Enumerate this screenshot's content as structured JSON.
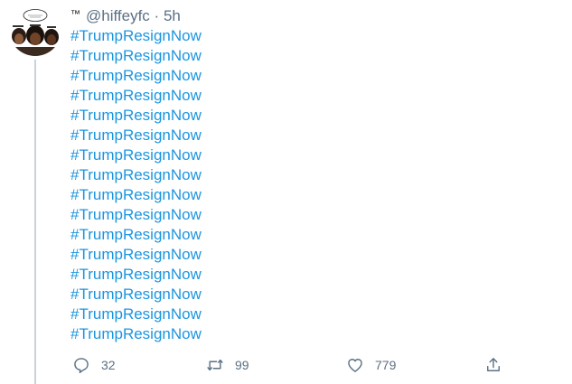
{
  "tweet": {
    "display_name": "™",
    "handle": "@hiffeyfc",
    "separator": "·",
    "time": "5h",
    "hashtags": [
      "#TrumpResignNow",
      "#TrumpResignNow",
      "#TrumpResignNow",
      "#TrumpResignNow",
      "#TrumpResignNow",
      "#TrumpResignNow",
      "#TrumpResignNow",
      "#TrumpResignNow",
      "#TrumpResignNow",
      "#TrumpResignNow",
      "#TrumpResignNow",
      "#TrumpResignNow",
      "#TrumpResignNow",
      "#TrumpResignNow",
      "#TrumpResignNow",
      "#TrumpResignNow"
    ],
    "actions": {
      "replies": "32",
      "retweets": "99",
      "likes": "779"
    },
    "icons": {
      "reply": "reply-icon",
      "retweet": "retweet-icon",
      "like": "heart-icon",
      "share": "share-icon"
    },
    "colors": {
      "hashtag": "#1b95e0",
      "muted": "#5b7083",
      "thread_line": "#c9d3da"
    }
  }
}
